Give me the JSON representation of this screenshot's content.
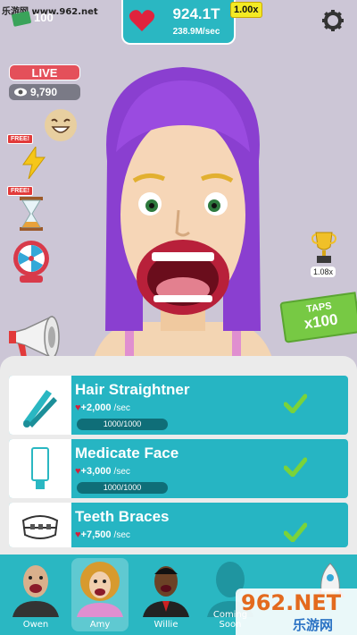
{
  "watermark_top": "乐游网 www.962.net",
  "currency": {
    "cash_amount": "100"
  },
  "stats": {
    "hearts_total": "924.1T",
    "hearts_rate": "238.9M/sec",
    "multiplier": "1.00x"
  },
  "live": {
    "label": "LIVE",
    "viewers": "9,790"
  },
  "boosts": {
    "free_label_1": "FREE!",
    "free_label_2": "FREE!"
  },
  "trophy": {
    "multiplier": "1.08x"
  },
  "taps": {
    "label": "TAPS",
    "value": "x100"
  },
  "upgrades": [
    {
      "name": "Hair Straightner",
      "rate": "+2,000",
      "unit": "/sec",
      "progress": "1000/1000",
      "progress_fraction": 1.0
    },
    {
      "name": "Medicate Face",
      "rate": "+3,000",
      "unit": "/sec",
      "progress": "1000/1000",
      "progress_fraction": 1.0
    },
    {
      "name": "Teeth Braces",
      "rate": "+7,500",
      "unit": "/sec"
    }
  ],
  "characters": [
    {
      "name": "Owen"
    },
    {
      "name": "Amy",
      "selected": true
    },
    {
      "name": "Willie"
    },
    {
      "name": "Coming Soon"
    }
  ],
  "watermark_bottom": {
    "logo": "962.NET",
    "site": "乐游网"
  },
  "colors": {
    "teal": "#26b5c3",
    "live_red": "#e4505a",
    "taps_green": "#77c944",
    "hair_purple": "#8a3fd0"
  }
}
